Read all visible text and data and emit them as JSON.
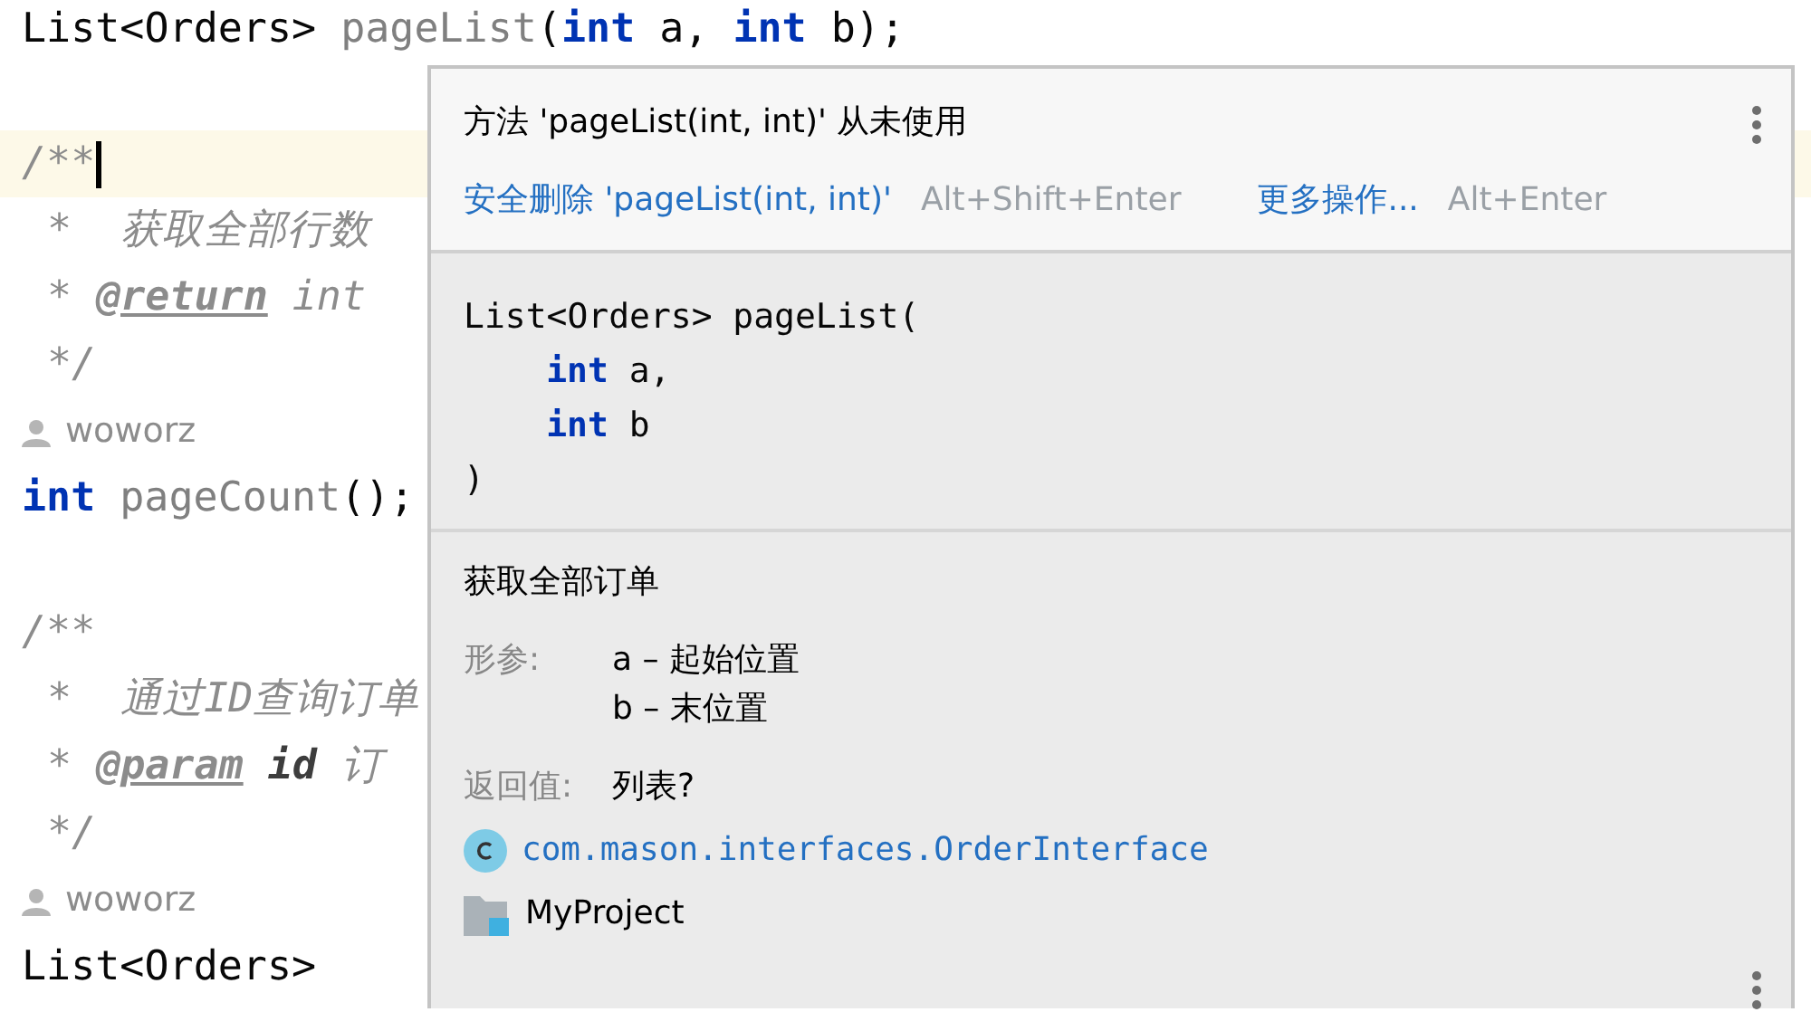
{
  "editor": {
    "lines": [
      {
        "kind": "code",
        "tokens": [
          {
            "kind": "plain",
            "text": "List<Orders>"
          },
          {
            "kind": "method",
            "text": "pageList"
          },
          {
            "kind": "plain",
            "text": "("
          },
          {
            "kind": "keyword",
            "text": "int"
          },
          {
            "kind": "plain",
            "text": "a,"
          },
          {
            "kind": "keyword",
            "text": "int"
          },
          {
            "kind": "plain",
            "text": "b);"
          }
        ]
      },
      {
        "kind": "blank"
      },
      {
        "kind": "code",
        "highlighted": true,
        "caret": true,
        "tokens": [
          {
            "kind": "comment",
            "text": "/**"
          }
        ]
      },
      {
        "kind": "code",
        "tokens": [
          {
            "kind": "comment",
            "text": "*"
          },
          {
            "kind": "comment",
            "text": "获取全部行数"
          }
        ]
      },
      {
        "kind": "code",
        "tokens": [
          {
            "kind": "comment",
            "text": "*"
          },
          {
            "kind": "doc_tag",
            "text": "@return"
          },
          {
            "kind": "comment",
            "text": "int"
          }
        ]
      },
      {
        "kind": "code",
        "tokens": [
          {
            "kind": "comment",
            "text": "*/"
          }
        ]
      },
      {
        "kind": "code",
        "tokens": [
          {
            "kind": "author",
            "text": "woworz"
          }
        ]
      },
      {
        "kind": "code",
        "tokens": [
          {
            "kind": "keyword",
            "text": "int"
          },
          {
            "kind": "method",
            "text": "pageCount"
          },
          {
            "kind": "plain",
            "text": "();"
          }
        ]
      },
      {
        "kind": "blank"
      },
      {
        "kind": "code",
        "tokens": [
          {
            "kind": "comment",
            "text": "/**"
          }
        ]
      },
      {
        "kind": "code",
        "tokens": [
          {
            "kind": "comment",
            "text": "*"
          },
          {
            "kind": "comment",
            "text": "通过ID查询订单"
          }
        ]
      },
      {
        "kind": "code",
        "tokens": [
          {
            "kind": "comment",
            "text": "*"
          },
          {
            "kind": "doc_tag",
            "text": "@param"
          },
          {
            "kind": "doc_param",
            "text": "id"
          },
          {
            "kind": "comment",
            "text": "订"
          }
        ]
      },
      {
        "kind": "code",
        "tokens": [
          {
            "kind": "comment",
            "text": "*/"
          }
        ]
      },
      {
        "kind": "code",
        "tokens": [
          {
            "kind": "author",
            "text": "woworz"
          }
        ]
      },
      {
        "kind": "code",
        "tokens": [
          {
            "kind": "plain",
            "text": "List<Orders>"
          }
        ]
      }
    ]
  },
  "popup": {
    "title": "方法 'pageList(int, int)' 从未使用",
    "actions": [
      {
        "label": "安全删除 'pageList(int, int)'",
        "shortcut": "Alt+Shift+Enter"
      },
      {
        "label": "更多操作...",
        "shortcut": "Alt+Enter"
      }
    ],
    "signature": [
      {
        "indented": false,
        "tokens": [
          {
            "kind": "plain",
            "text": "List<Orders>"
          },
          {
            "kind": "plain",
            "text": "pageList("
          }
        ]
      },
      {
        "indented": true,
        "tokens": [
          {
            "kind": "keyword",
            "text": "int"
          },
          {
            "kind": "plain",
            "text": "a,"
          }
        ]
      },
      {
        "indented": true,
        "tokens": [
          {
            "kind": "keyword",
            "text": "int"
          },
          {
            "kind": "plain",
            "text": "b"
          }
        ]
      },
      {
        "indented": false,
        "tokens": [
          {
            "kind": "plain",
            "text": ")"
          }
        ]
      }
    ],
    "description": "获取全部订单",
    "params_label": "形参:",
    "params": [
      "a – 起始位置",
      "b – 末位置"
    ],
    "return_label": "返回值:",
    "return_value": "列表?",
    "class_name": "com.mason.interfaces.OrderInterface",
    "project": "MyProject"
  }
}
